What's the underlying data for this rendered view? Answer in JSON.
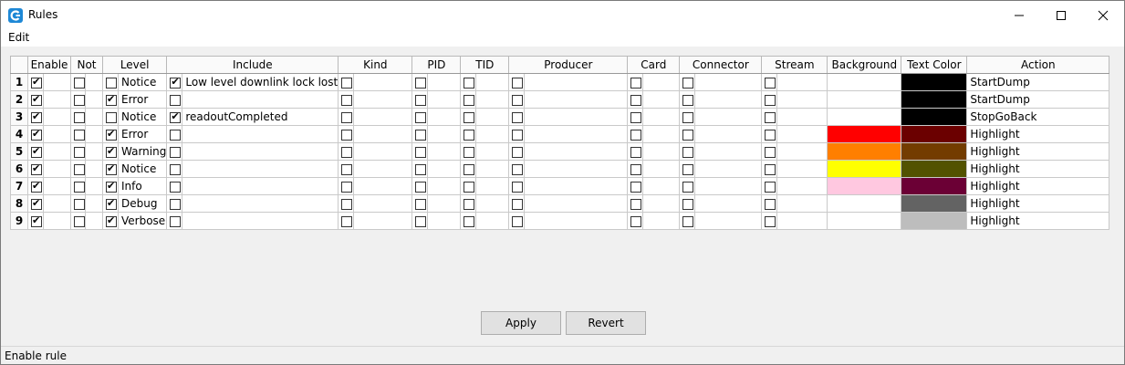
{
  "window": {
    "title": "Rules",
    "menu": {
      "edit_label": "Edit"
    }
  },
  "table": {
    "columns": [
      "Enable",
      "Not",
      "Level",
      "Include",
      "Kind",
      "PID",
      "TID",
      "Producer",
      "Card",
      "Connector",
      "Stream",
      "Background",
      "Text Color",
      "Action"
    ],
    "rows": [
      {
        "num": "1",
        "enable": true,
        "not": false,
        "level_check": false,
        "level": "Notice",
        "include_check": true,
        "include": "Low level downlink lock lost",
        "bg": "",
        "fg": "#000000",
        "action": "StartDump"
      },
      {
        "num": "2",
        "enable": true,
        "not": false,
        "level_check": true,
        "level": "Error",
        "include_check": false,
        "include": "",
        "bg": "",
        "fg": "#000000",
        "action": "StartDump"
      },
      {
        "num": "3",
        "enable": true,
        "not": false,
        "level_check": false,
        "level": "Notice",
        "include_check": true,
        "include": "readoutCompleted",
        "bg": "",
        "fg": "#000000",
        "action": "StopGoBack"
      },
      {
        "num": "4",
        "enable": true,
        "not": false,
        "level_check": true,
        "level": "Error",
        "include_check": false,
        "include": "",
        "bg": "#ff0000",
        "fg": "#6b0000",
        "action": "Highlight"
      },
      {
        "num": "5",
        "enable": true,
        "not": false,
        "level_check": true,
        "level": "Warning",
        "include_check": false,
        "include": "",
        "bg": "#ff7f00",
        "fg": "#733c00",
        "action": "Highlight"
      },
      {
        "num": "6",
        "enable": true,
        "not": false,
        "level_check": true,
        "level": "Notice",
        "include_check": false,
        "include": "",
        "bg": "#ffff00",
        "fg": "#525200",
        "action": "Highlight"
      },
      {
        "num": "7",
        "enable": true,
        "not": false,
        "level_check": true,
        "level": "Info",
        "include_check": false,
        "include": "",
        "bg": "#ffc8e0",
        "fg": "#6b0035",
        "action": "Highlight"
      },
      {
        "num": "8",
        "enable": true,
        "not": false,
        "level_check": true,
        "level": "Debug",
        "include_check": false,
        "include": "",
        "bg": "",
        "fg": "#636363",
        "action": "Highlight"
      },
      {
        "num": "9",
        "enable": true,
        "not": false,
        "level_check": true,
        "level": "Verbose",
        "include_check": false,
        "include": "",
        "bg": "",
        "fg": "#bdbdbd",
        "action": "Highlight"
      }
    ]
  },
  "buttons": {
    "apply": "Apply",
    "revert": "Revert"
  },
  "status": {
    "text": "Enable rule"
  }
}
